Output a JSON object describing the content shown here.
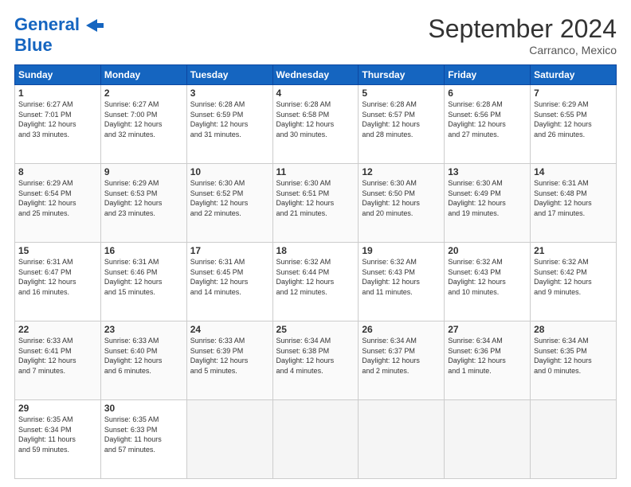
{
  "header": {
    "logo_line1": "General",
    "logo_line2": "Blue",
    "month_title": "September 2024",
    "location": "Carranco, Mexico"
  },
  "weekdays": [
    "Sunday",
    "Monday",
    "Tuesday",
    "Wednesday",
    "Thursday",
    "Friday",
    "Saturday"
  ],
  "weeks": [
    [
      {
        "day": "1",
        "lines": [
          "Sunrise: 6:27 AM",
          "Sunset: 7:01 PM",
          "Daylight: 12 hours",
          "and 33 minutes."
        ]
      },
      {
        "day": "2",
        "lines": [
          "Sunrise: 6:27 AM",
          "Sunset: 7:00 PM",
          "Daylight: 12 hours",
          "and 32 minutes."
        ]
      },
      {
        "day": "3",
        "lines": [
          "Sunrise: 6:28 AM",
          "Sunset: 6:59 PM",
          "Daylight: 12 hours",
          "and 31 minutes."
        ]
      },
      {
        "day": "4",
        "lines": [
          "Sunrise: 6:28 AM",
          "Sunset: 6:58 PM",
          "Daylight: 12 hours",
          "and 30 minutes."
        ]
      },
      {
        "day": "5",
        "lines": [
          "Sunrise: 6:28 AM",
          "Sunset: 6:57 PM",
          "Daylight: 12 hours",
          "and 28 minutes."
        ]
      },
      {
        "day": "6",
        "lines": [
          "Sunrise: 6:28 AM",
          "Sunset: 6:56 PM",
          "Daylight: 12 hours",
          "and 27 minutes."
        ]
      },
      {
        "day": "7",
        "lines": [
          "Sunrise: 6:29 AM",
          "Sunset: 6:55 PM",
          "Daylight: 12 hours",
          "and 26 minutes."
        ]
      }
    ],
    [
      {
        "day": "8",
        "lines": [
          "Sunrise: 6:29 AM",
          "Sunset: 6:54 PM",
          "Daylight: 12 hours",
          "and 25 minutes."
        ]
      },
      {
        "day": "9",
        "lines": [
          "Sunrise: 6:29 AM",
          "Sunset: 6:53 PM",
          "Daylight: 12 hours",
          "and 23 minutes."
        ]
      },
      {
        "day": "10",
        "lines": [
          "Sunrise: 6:30 AM",
          "Sunset: 6:52 PM",
          "Daylight: 12 hours",
          "and 22 minutes."
        ]
      },
      {
        "day": "11",
        "lines": [
          "Sunrise: 6:30 AM",
          "Sunset: 6:51 PM",
          "Daylight: 12 hours",
          "and 21 minutes."
        ]
      },
      {
        "day": "12",
        "lines": [
          "Sunrise: 6:30 AM",
          "Sunset: 6:50 PM",
          "Daylight: 12 hours",
          "and 20 minutes."
        ]
      },
      {
        "day": "13",
        "lines": [
          "Sunrise: 6:30 AM",
          "Sunset: 6:49 PM",
          "Daylight: 12 hours",
          "and 19 minutes."
        ]
      },
      {
        "day": "14",
        "lines": [
          "Sunrise: 6:31 AM",
          "Sunset: 6:48 PM",
          "Daylight: 12 hours",
          "and 17 minutes."
        ]
      }
    ],
    [
      {
        "day": "15",
        "lines": [
          "Sunrise: 6:31 AM",
          "Sunset: 6:47 PM",
          "Daylight: 12 hours",
          "and 16 minutes."
        ]
      },
      {
        "day": "16",
        "lines": [
          "Sunrise: 6:31 AM",
          "Sunset: 6:46 PM",
          "Daylight: 12 hours",
          "and 15 minutes."
        ]
      },
      {
        "day": "17",
        "lines": [
          "Sunrise: 6:31 AM",
          "Sunset: 6:45 PM",
          "Daylight: 12 hours",
          "and 14 minutes."
        ]
      },
      {
        "day": "18",
        "lines": [
          "Sunrise: 6:32 AM",
          "Sunset: 6:44 PM",
          "Daylight: 12 hours",
          "and 12 minutes."
        ]
      },
      {
        "day": "19",
        "lines": [
          "Sunrise: 6:32 AM",
          "Sunset: 6:43 PM",
          "Daylight: 12 hours",
          "and 11 minutes."
        ]
      },
      {
        "day": "20",
        "lines": [
          "Sunrise: 6:32 AM",
          "Sunset: 6:43 PM",
          "Daylight: 12 hours",
          "and 10 minutes."
        ]
      },
      {
        "day": "21",
        "lines": [
          "Sunrise: 6:32 AM",
          "Sunset: 6:42 PM",
          "Daylight: 12 hours",
          "and 9 minutes."
        ]
      }
    ],
    [
      {
        "day": "22",
        "lines": [
          "Sunrise: 6:33 AM",
          "Sunset: 6:41 PM",
          "Daylight: 12 hours",
          "and 7 minutes."
        ]
      },
      {
        "day": "23",
        "lines": [
          "Sunrise: 6:33 AM",
          "Sunset: 6:40 PM",
          "Daylight: 12 hours",
          "and 6 minutes."
        ]
      },
      {
        "day": "24",
        "lines": [
          "Sunrise: 6:33 AM",
          "Sunset: 6:39 PM",
          "Daylight: 12 hours",
          "and 5 minutes."
        ]
      },
      {
        "day": "25",
        "lines": [
          "Sunrise: 6:34 AM",
          "Sunset: 6:38 PM",
          "Daylight: 12 hours",
          "and 4 minutes."
        ]
      },
      {
        "day": "26",
        "lines": [
          "Sunrise: 6:34 AM",
          "Sunset: 6:37 PM",
          "Daylight: 12 hours",
          "and 2 minutes."
        ]
      },
      {
        "day": "27",
        "lines": [
          "Sunrise: 6:34 AM",
          "Sunset: 6:36 PM",
          "Daylight: 12 hours",
          "and 1 minute."
        ]
      },
      {
        "day": "28",
        "lines": [
          "Sunrise: 6:34 AM",
          "Sunset: 6:35 PM",
          "Daylight: 12 hours",
          "and 0 minutes."
        ]
      }
    ],
    [
      {
        "day": "29",
        "lines": [
          "Sunrise: 6:35 AM",
          "Sunset: 6:34 PM",
          "Daylight: 11 hours",
          "and 59 minutes."
        ]
      },
      {
        "day": "30",
        "lines": [
          "Sunrise: 6:35 AM",
          "Sunset: 6:33 PM",
          "Daylight: 11 hours",
          "and 57 minutes."
        ]
      },
      {
        "day": "",
        "lines": []
      },
      {
        "day": "",
        "lines": []
      },
      {
        "day": "",
        "lines": []
      },
      {
        "day": "",
        "lines": []
      },
      {
        "day": "",
        "lines": []
      }
    ]
  ]
}
